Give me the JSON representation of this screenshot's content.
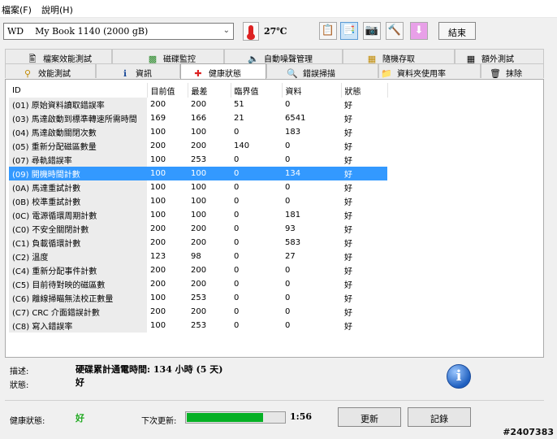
{
  "menu": {
    "file": "檔案(F)",
    "help": "說明(H)"
  },
  "toolbar": {
    "drive": "WD    My Book 1140 (2000 gB)",
    "temperature": "27℃",
    "exit": "結束",
    "icons": [
      "copy-icon",
      "copy-active-icon",
      "camera-icon",
      "tools-icon",
      "download-icon"
    ]
  },
  "tabs": {
    "row1": [
      "檔案效能測試",
      "磁碟監控",
      "自動噪聲管理",
      "隨機存取",
      "額外測試"
    ],
    "row2": [
      "效能測試",
      "資訊",
      "健康狀態",
      "錯誤掃描",
      "資料夾使用率",
      "抹除"
    ],
    "active": "健康狀態"
  },
  "table": {
    "headers": [
      "ID",
      "目前值",
      "最差",
      "臨界值",
      "資料",
      "狀態"
    ],
    "rows": [
      [
        "(01) 原始資料讀取錯誤率",
        "200",
        "200",
        "51",
        "0",
        "好"
      ],
      [
        "(03) 馬達啟動到標準轉速所需時間",
        "169",
        "166",
        "21",
        "6541",
        "好"
      ],
      [
        "(04) 馬達啟動關閉次數",
        "100",
        "100",
        "0",
        "183",
        "好"
      ],
      [
        "(05) 重新分配磁區數量",
        "200",
        "200",
        "140",
        "0",
        "好"
      ],
      [
        "(07) 尋軌錯誤率",
        "100",
        "253",
        "0",
        "0",
        "好"
      ],
      [
        "(09) 開機時間計數",
        "100",
        "100",
        "0",
        "134",
        "好"
      ],
      [
        "(0A) 馬達重試計數",
        "100",
        "100",
        "0",
        "0",
        "好"
      ],
      [
        "(0B) 校準重試計數",
        "100",
        "100",
        "0",
        "0",
        "好"
      ],
      [
        "(0C) 電源循環周期計數",
        "100",
        "100",
        "0",
        "181",
        "好"
      ],
      [
        "(C0) 不安全關閉計數",
        "200",
        "200",
        "0",
        "93",
        "好"
      ],
      [
        "(C1) 負載循環計數",
        "200",
        "200",
        "0",
        "583",
        "好"
      ],
      [
        "(C2) 溫度",
        "123",
        "98",
        "0",
        "27",
        "好"
      ],
      [
        "(C4) 重新分配事件計數",
        "200",
        "200",
        "0",
        "0",
        "好"
      ],
      [
        "(C5) 目前待對映的磁區數",
        "200",
        "200",
        "0",
        "0",
        "好"
      ],
      [
        "(C6) 離線掃瞄無法校正數量",
        "100",
        "253",
        "0",
        "0",
        "好"
      ],
      [
        "(C7) CRC 介面錯誤計數",
        "200",
        "200",
        "0",
        "0",
        "好"
      ],
      [
        "(C8) 寫入錯誤率",
        "100",
        "253",
        "0",
        "0",
        "好"
      ]
    ],
    "selected_row": 5
  },
  "details": {
    "desc_label": "描述:",
    "desc_value": "硬碟累計通電時間: 134 小時 (5 天)",
    "status_label": "狀態:",
    "status_value": "好"
  },
  "footer": {
    "health_label": "健康狀態:",
    "health_value": "好",
    "health_color": "#22aa22",
    "next_update_label": "下次更新:",
    "progress": 0.78,
    "countdown": "1:56",
    "update_button": "更新",
    "log_button": "記錄"
  },
  "watermark": "#2407383",
  "colors": {
    "selected_row": "#3399ff",
    "progress": "#06b025"
  }
}
